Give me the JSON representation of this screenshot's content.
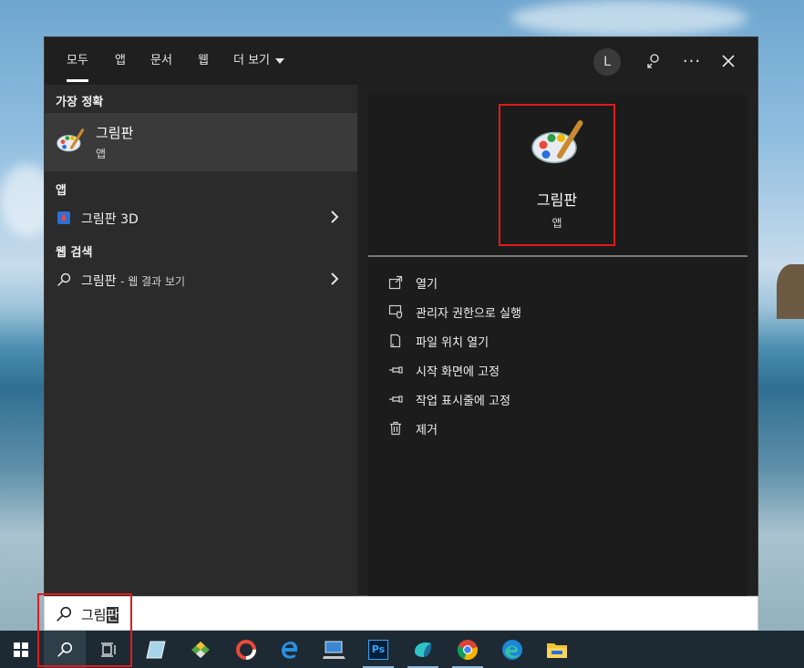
{
  "tabs": [
    "모두",
    "앱",
    "문서",
    "웹"
  ],
  "more_tab": "더 보기",
  "avatar_letter": "L",
  "left": {
    "best_match_heading": "가장 정확",
    "best_match": {
      "name": "그림판",
      "type": "앱"
    },
    "apps_heading": "앱",
    "apps": [
      {
        "name": "그림판 3D"
      }
    ],
    "web_heading": "웹 검색",
    "web": {
      "query": "그림판",
      "suffix": "- 웹 결과 보기"
    }
  },
  "right": {
    "app_name": "그림판",
    "app_type": "앱",
    "actions": [
      {
        "icon": "open-icon",
        "label": "열기"
      },
      {
        "icon": "shield-icon",
        "label": "관리자 권한으로 실행"
      },
      {
        "icon": "file-location-icon",
        "label": "파일 위치 열기"
      },
      {
        "icon": "pin-icon",
        "label": "시작 화면에 고정"
      },
      {
        "icon": "pin-icon",
        "label": "작업 표시줄에 고정"
      },
      {
        "icon": "trash-icon",
        "label": "제거"
      }
    ]
  },
  "search": {
    "typed": "그림",
    "selected": "판"
  },
  "taskbar": {
    "icons": [
      "windows-start-icon",
      "search-icon",
      "task-view-icon",
      "notepad-icon",
      "network-icon",
      "app-icon",
      "edge-legacy-icon",
      "computer-icon",
      "photoshop-icon",
      "app-icon",
      "chrome-icon",
      "edge-icon",
      "file-explorer-icon"
    ],
    "ps_label": "Ps"
  },
  "colors": {
    "accent_red": "#e01b1b",
    "panel": "#202020",
    "left_pane": "#2b2b2b",
    "taskbar": "#1d2a33"
  }
}
